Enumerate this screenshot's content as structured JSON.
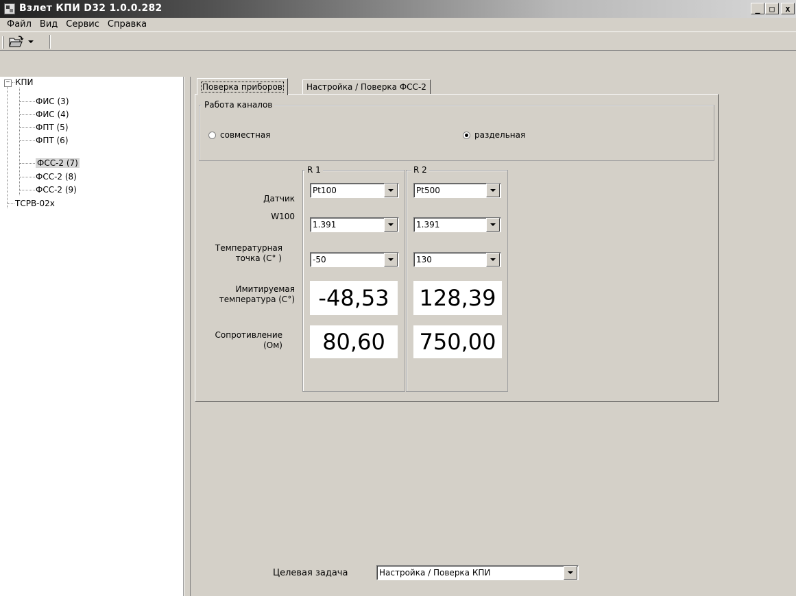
{
  "window": {
    "title": "Взлет КПИ D32  1.0.0.282",
    "minimize": "_",
    "maximize": "□",
    "close": "x"
  },
  "menu": [
    "Файл",
    "Вид",
    "Сервис",
    "Справка"
  ],
  "tree": {
    "root": "КПИ",
    "expander": "−",
    "children": [
      "ФИС (3)",
      "ФИС (4)",
      "ФПТ (5)",
      "ФПТ (6)",
      "ФСС-2 (7)",
      "ФСС-2 (8)",
      "ФСС-2 (9)"
    ],
    "selected": "ФСС-2 (7)",
    "sibling": "ТСРВ-02х"
  },
  "tabs": [
    "Поверка приборов",
    "Настройка / Поверка ФСС-2"
  ],
  "channels": {
    "title": "Работа каналов",
    "options": [
      "совместная",
      "раздельная"
    ],
    "selected": "раздельная"
  },
  "labels": {
    "sensor": "Датчик",
    "w100": "W100",
    "temp_point_1": "Температурная",
    "temp_point_2": "точка (С° )",
    "sim_temp_1": "Имитируемая",
    "sim_temp_2": "температура (С°)",
    "resistance_1": "Сопротивление",
    "resistance_2": "(Ом)"
  },
  "r1": {
    "title": "R 1",
    "sensor": "Pt100",
    "w100": "1.391",
    "temp_point": "-50",
    "sim_temp": "-48,53",
    "resistance": "80,60"
  },
  "r2": {
    "title": "R 2",
    "sensor": "Pt500",
    "w100": "1.391",
    "temp_point": "130",
    "sim_temp": "128,39",
    "resistance": "750,00"
  },
  "target_task": {
    "label": "Целевая задача",
    "value": "Настройка / Поверка КПИ"
  }
}
